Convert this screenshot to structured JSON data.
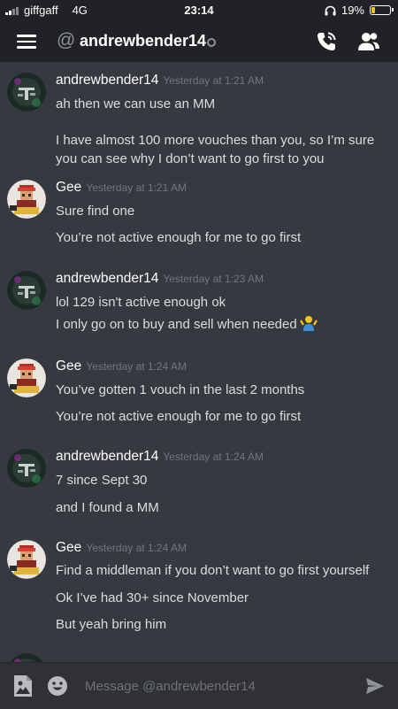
{
  "status_bar": {
    "carrier": "giffgaff",
    "network": "4G",
    "time": "23:14",
    "battery": "19%",
    "battery_level": 0.19
  },
  "header": {
    "channel_prefix": "@",
    "title": "andrewbender14",
    "icons": [
      "hamburger-menu-icon",
      "phone-call-icon",
      "members-icon"
    ]
  },
  "messages": [
    {
      "author": "andrewbender14",
      "timestamp": "Yesterday at 1:21 AM",
      "avatar": "tsm-logo-avatar",
      "lines": [
        "ah then we can use an MM",
        "I have almost 100 more vouches than you, so I’m sure you can see why I don’t want to go first to you"
      ]
    },
    {
      "author": "Gee",
      "timestamp": "Yesterday at 1:21 AM",
      "avatar": "pixel-character-avatar",
      "lines": [
        "Sure find one",
        "You’re not active enough for me to go first"
      ]
    },
    {
      "author": "andrewbender14",
      "timestamp": "Yesterday at 1:23 AM",
      "avatar": "tsm-logo-avatar",
      "lines": [
        "lol 129 isn't active enough ok",
        "I only go on to buy and sell when needed"
      ]
    },
    {
      "author": "Gee",
      "timestamp": "Yesterday at 1:24 AM",
      "avatar": "pixel-character-avatar",
      "lines": [
        "You’ve gotten 1 vouch in the last 2 months",
        "You’re not active enough for me to go first"
      ]
    },
    {
      "author": "andrewbender14",
      "timestamp": "Yesterday at 1:24 AM",
      "avatar": "tsm-logo-avatar",
      "lines": [
        "7 since Sept 30",
        "and I found a MM"
      ]
    },
    {
      "author": "Gee",
      "timestamp": "Yesterday at 1:24 AM",
      "avatar": "pixel-character-avatar",
      "lines": [
        "Find a middleman if you don’t want to go first yourself",
        "Ok I’ve had 30+ since November",
        "But yeah bring him"
      ]
    }
  ],
  "input": {
    "placeholder": "Message @andrewbender14"
  },
  "colors": {
    "background": "#36393f",
    "header": "#202225",
    "input_bar": "#2f3136",
    "timestamp": "#72767d",
    "text": "#dcddde",
    "battery": "#f5c518"
  }
}
